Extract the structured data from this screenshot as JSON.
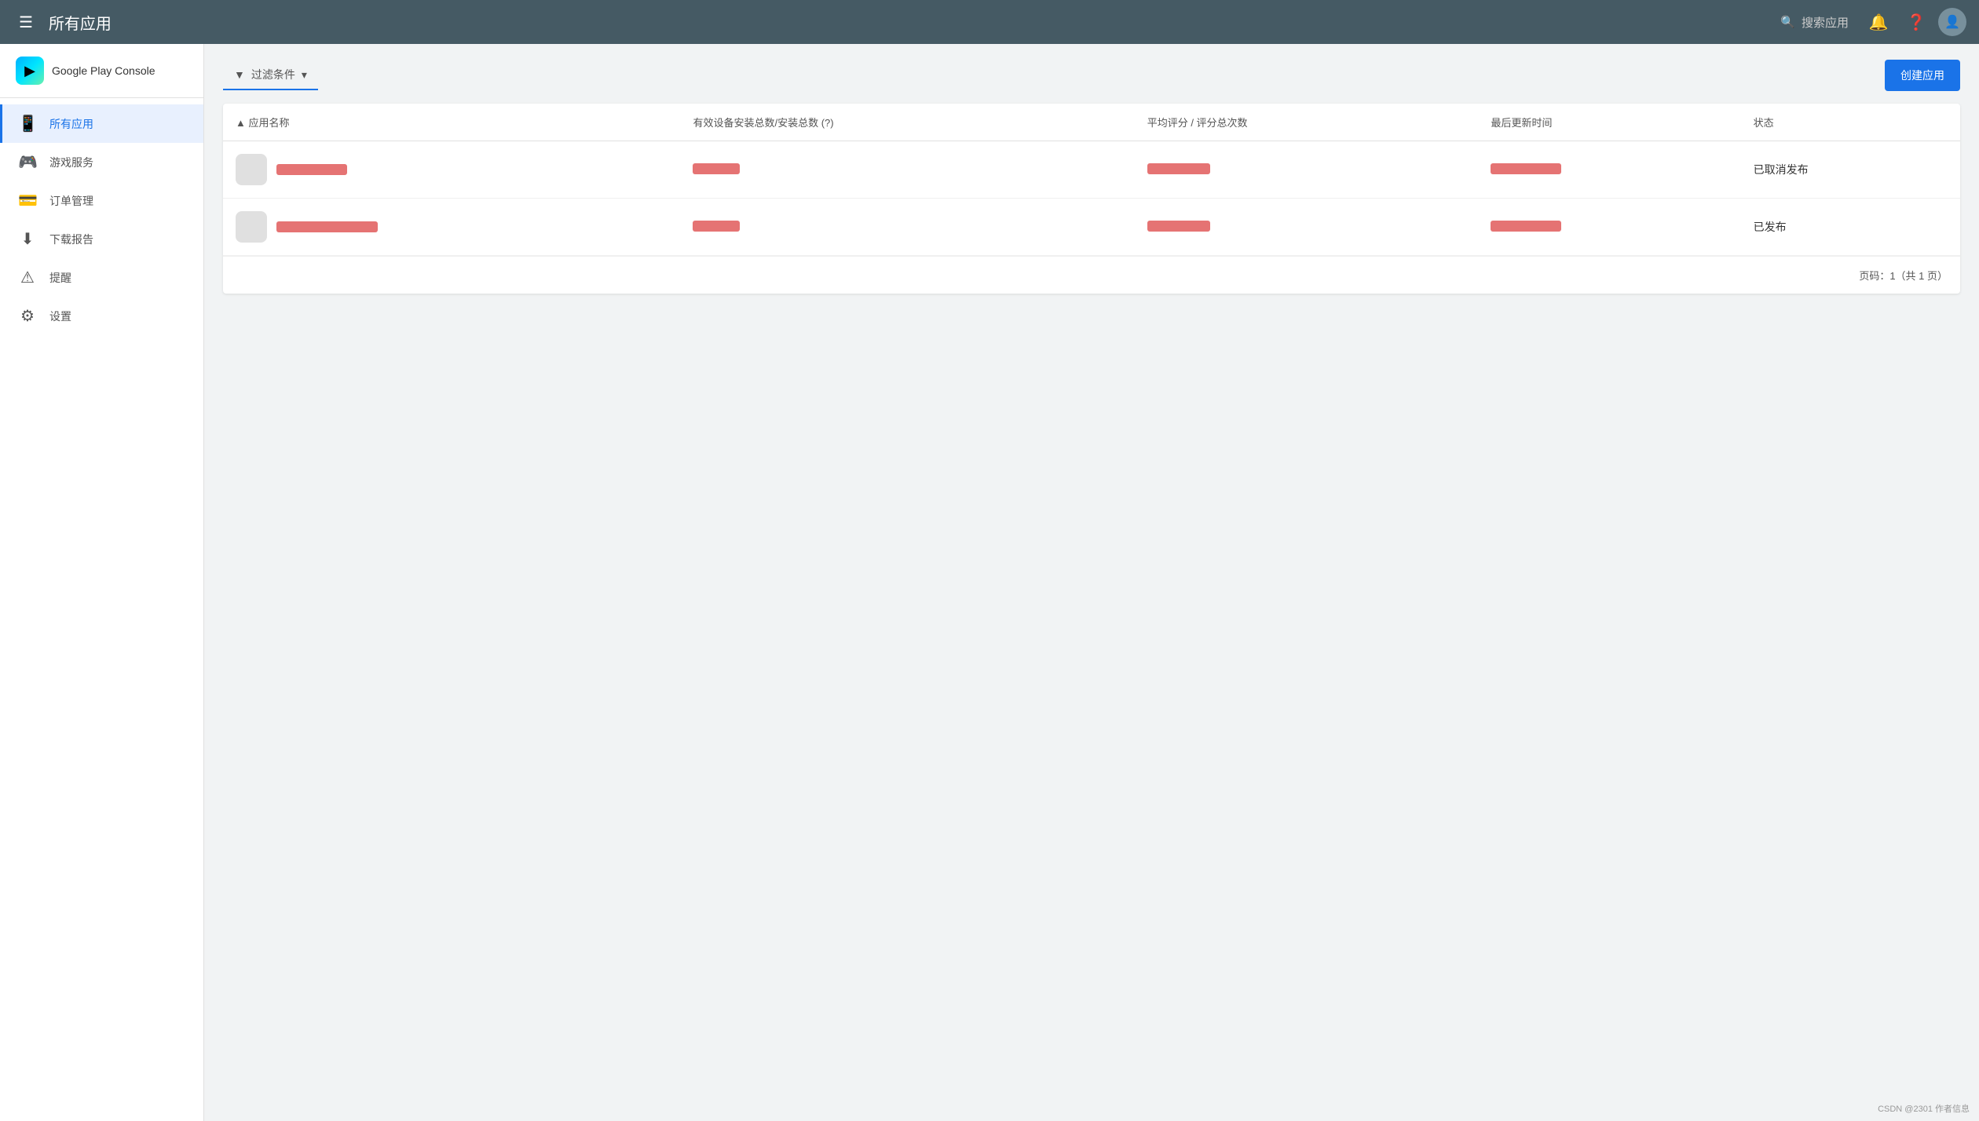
{
  "app": {
    "logo_text": "Google Play Console",
    "logo_emoji": "▶"
  },
  "header": {
    "title": "所有应用",
    "search_placeholder": "搜索应用",
    "hamburger_label": "☰"
  },
  "sidebar": {
    "items": [
      {
        "id": "all-apps",
        "label": "所有应用",
        "icon": "📱",
        "active": true
      },
      {
        "id": "game-services",
        "label": "游戏服务",
        "icon": "🎮",
        "active": false
      },
      {
        "id": "order-management",
        "label": "订单管理",
        "icon": "💳",
        "active": false
      },
      {
        "id": "download-report",
        "label": "下载报告",
        "icon": "⬇",
        "active": false
      },
      {
        "id": "alerts",
        "label": "提醒",
        "icon": "⚠",
        "active": false
      },
      {
        "id": "settings",
        "label": "设置",
        "icon": "⚙",
        "active": false
      }
    ]
  },
  "toolbar": {
    "filter_label": "过滤条件",
    "create_button_label": "创建应用"
  },
  "table": {
    "columns": [
      {
        "id": "app-name",
        "label": "应用名称",
        "sortable": true,
        "sort_direction": "asc"
      },
      {
        "id": "installs",
        "label": "有效设备安装总数/安装总数 (?)",
        "sortable": false
      },
      {
        "id": "rating",
        "label": "平均评分 / 评分总次数",
        "sortable": false
      },
      {
        "id": "last-updated",
        "label": "最后更新时间",
        "sortable": false
      },
      {
        "id": "status",
        "label": "状态",
        "sortable": false
      }
    ],
    "rows": [
      {
        "id": "row-1",
        "app_name_redacted": true,
        "installs_redacted": true,
        "rating_redacted": true,
        "last_updated_redacted": true,
        "status": "已取消发布"
      },
      {
        "id": "row-2",
        "app_name_redacted": true,
        "installs_redacted": true,
        "rating_redacted": true,
        "last_updated_redacted": true,
        "status": "已发布"
      }
    ]
  },
  "pagination": {
    "text": "页码：1（共 1 页）"
  },
  "watermark": {
    "text": "CSDN @2301 作者信息"
  }
}
